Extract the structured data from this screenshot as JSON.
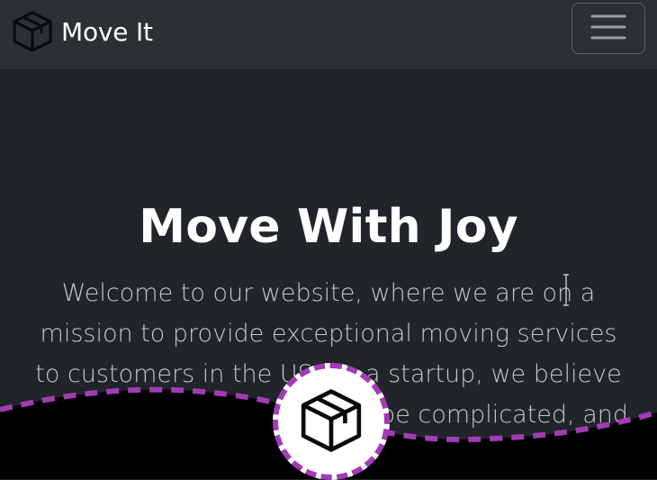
{
  "navbar": {
    "brand_icon": "box-icon",
    "brand_text": "Move It",
    "toggler_icon": "hamburger-icon"
  },
  "hero": {
    "title": "Move With Joy",
    "text": "Welcome to our website, where we are on a mission to provide exceptional moving services to customers in the US. As a startup, we believe that moving doesn't have to be complicated, and we"
  },
  "fab": {
    "icon": "box-icon"
  },
  "colors": {
    "background": "#212529",
    "navbar": "#2b3035",
    "accent_dashed": "#a23bb5",
    "text_muted": "#c3c7cc"
  }
}
